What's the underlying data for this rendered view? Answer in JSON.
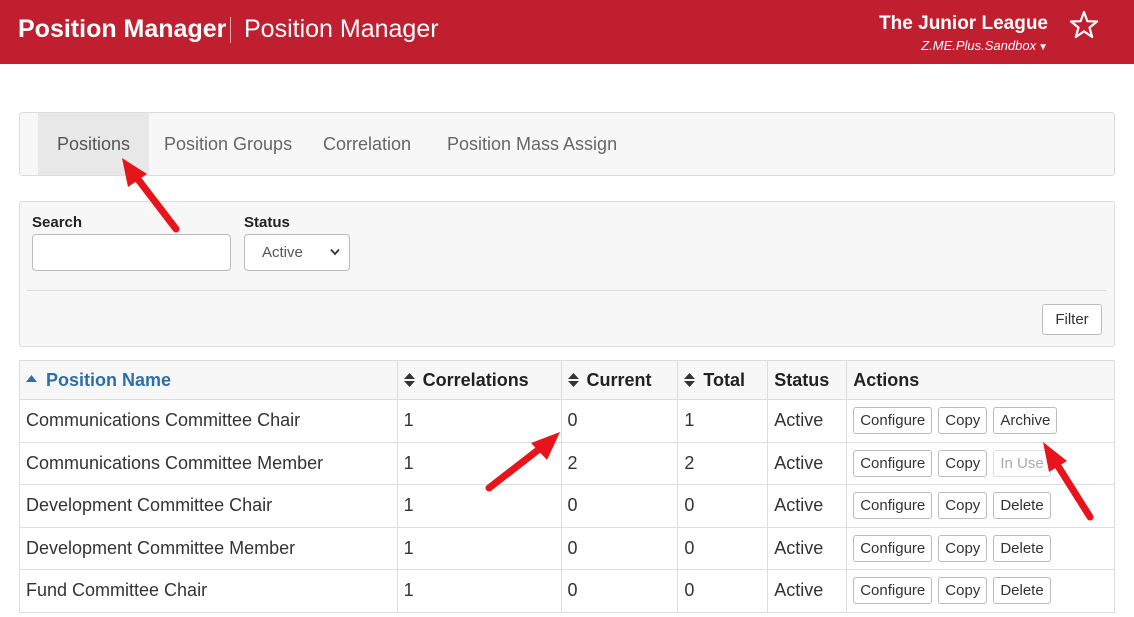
{
  "header": {
    "app_title": "Position Manager",
    "page_title": "Position Manager",
    "org_name": "The Junior League",
    "org_account": "Z.ME.Plus.Sandbox",
    "brand_color": "#c01f30",
    "favorite_icon": "star-icon"
  },
  "tabs": [
    {
      "label": "Positions",
      "active": true
    },
    {
      "label": "Position Groups",
      "active": false
    },
    {
      "label": "Correlation",
      "active": false
    },
    {
      "label": "Position Mass Assign",
      "active": false
    }
  ],
  "filters": {
    "search_label": "Search",
    "search_value": "",
    "status_label": "Status",
    "status_value": "Active",
    "filter_button": "Filter"
  },
  "table": {
    "columns": [
      "Position Name",
      "Correlations",
      "Current",
      "Total",
      "Status",
      "Actions"
    ],
    "rows": [
      {
        "name": "Communications Committee Chair",
        "correlations": "1",
        "current": "0",
        "total": "1",
        "status": "Active",
        "actions": [
          "Configure",
          "Copy",
          "Archive"
        ]
      },
      {
        "name": "Communications Committee Member",
        "correlations": "1",
        "current": "2",
        "total": "2",
        "status": "Active",
        "actions": [
          "Configure",
          "Copy",
          "In Use"
        ]
      },
      {
        "name": "Development Committee Chair",
        "correlations": "1",
        "current": "0",
        "total": "0",
        "status": "Active",
        "actions": [
          "Configure",
          "Copy",
          "Delete"
        ]
      },
      {
        "name": "Development Committee Member",
        "correlations": "1",
        "current": "0",
        "total": "0",
        "status": "Active",
        "actions": [
          "Configure",
          "Copy",
          "Delete"
        ]
      },
      {
        "name": "Fund Committee Chair",
        "correlations": "1",
        "current": "0",
        "total": "0",
        "status": "Active",
        "actions": [
          "Configure",
          "Copy",
          "Delete"
        ]
      }
    ]
  },
  "annotation_color": "#e8141b"
}
